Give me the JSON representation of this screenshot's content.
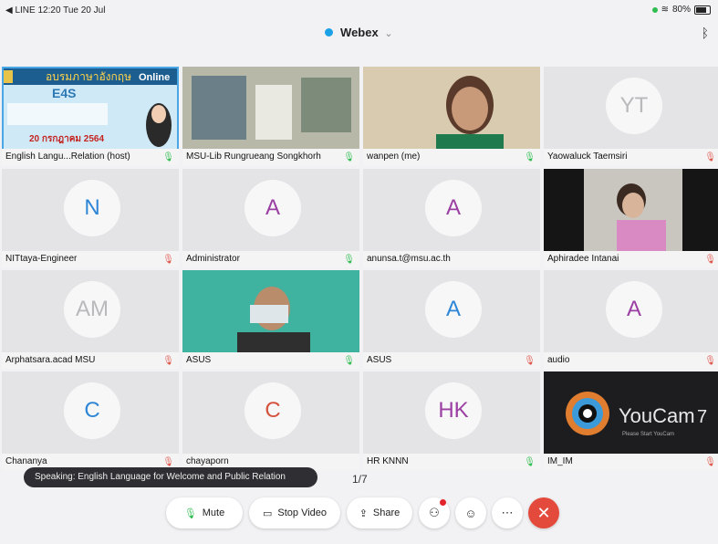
{
  "status": {
    "left": "◀ LINE  12:20  Tue 20 Jul",
    "battery": "80%"
  },
  "header": {
    "title": "Webex"
  },
  "banner": {
    "line1": "อบรมภาษาอังกฤษ",
    "online": "Online",
    "logo": "E4S",
    "date": "20 กรกฎาคม 2564"
  },
  "grid": {
    "r0": [
      {
        "name": "English Langu...Relation (host)"
      },
      {
        "name": "MSU-Lib Rungrueang Songkhorh"
      },
      {
        "name": "wanpen (me)"
      },
      {
        "name": "Yaowaluck Taemsiri",
        "initials": "YT"
      }
    ],
    "r1": [
      {
        "name": "NITtaya-Engineer",
        "initials": "N"
      },
      {
        "name": "Administrator",
        "initials": "A"
      },
      {
        "name": "anunsa.t@msu.ac.th",
        "initials": "A"
      },
      {
        "name": "Aphiradee Intanai"
      }
    ],
    "r2": [
      {
        "name": "Arphatsara.acad MSU",
        "initials": "AM"
      },
      {
        "name": "ASUS"
      },
      {
        "name": "ASUS",
        "initials": "A"
      },
      {
        "name": "audio",
        "initials": "A"
      }
    ],
    "r3": [
      {
        "name": "Chananya",
        "initials": "C"
      },
      {
        "name": "chayaporn",
        "initials": "C"
      },
      {
        "name": "HR KNNN",
        "initials": "HK"
      },
      {
        "name": "IM_IM"
      }
    ]
  },
  "youcam": {
    "brand": "YouCam",
    "version": "7",
    "sub": "Please Start YouCam"
  },
  "toast": "Speaking: English Language for Welcome and Public Relation",
  "page": "1/7",
  "controls": {
    "mute": "Mute",
    "stop_video": "Stop Video",
    "share": "Share"
  },
  "colors": {
    "avatar_blue": "#2f86d6",
    "avatar_purple": "#9b3fa2",
    "avatar_red": "#d5533e",
    "avatar_gray": "#b9b9bc"
  }
}
